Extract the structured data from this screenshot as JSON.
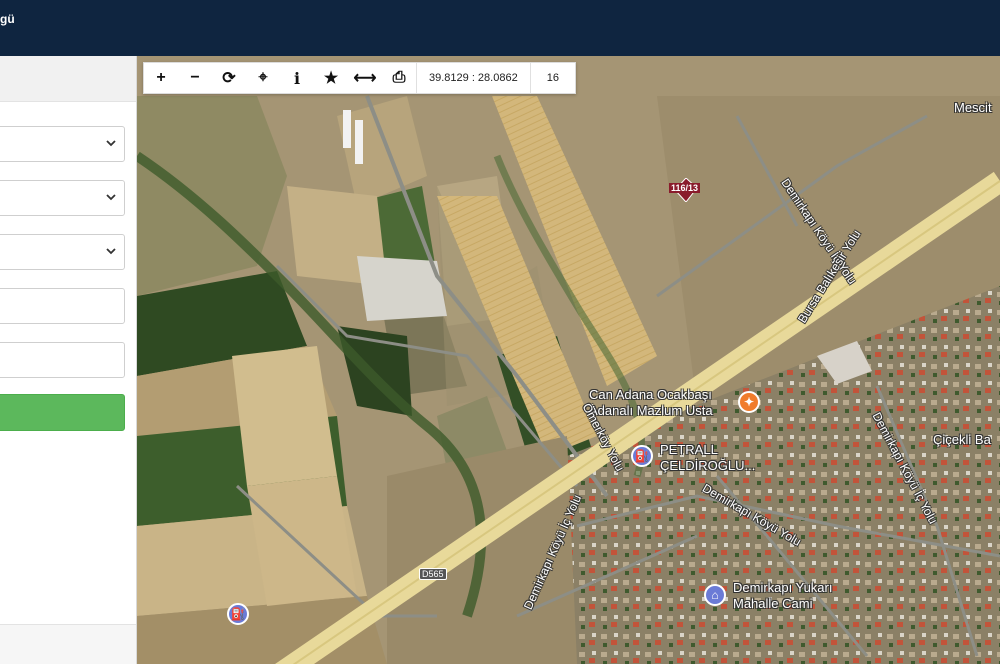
{
  "header": {
    "brand_fragment": "gü"
  },
  "sidebar": {
    "fields": [
      {
        "type": "select",
        "value": ""
      },
      {
        "type": "select",
        "value": ""
      },
      {
        "type": "select",
        "value": ""
      },
      {
        "type": "text",
        "value": ""
      },
      {
        "type": "text",
        "value": ""
      }
    ],
    "submit_label": ""
  },
  "toolbar": {
    "buttons": [
      {
        "name": "zoom-in",
        "icon": "plus-icon",
        "glyph": "+"
      },
      {
        "name": "zoom-out",
        "icon": "minus-icon",
        "glyph": "−"
      },
      {
        "name": "refresh",
        "icon": "refresh-icon",
        "glyph": "⟳"
      },
      {
        "name": "locate",
        "icon": "crosshair-icon",
        "glyph": "⌖"
      },
      {
        "name": "info",
        "icon": "info-icon",
        "glyph": "i"
      },
      {
        "name": "favorite",
        "icon": "star-icon",
        "glyph": "★"
      },
      {
        "name": "measure",
        "icon": "measure-icon",
        "glyph": "⟷"
      },
      {
        "name": "print",
        "icon": "print-icon",
        "glyph": "⎙"
      }
    ],
    "coordinates": "39.8129 : 28.0862",
    "zoom_level": "16"
  },
  "map": {
    "parcel_label": "116/13",
    "labels": {
      "mescit": "Mescit",
      "demirkapi_koyu_ic_yolu_north": "Demirkapı Köyü İç Yolu",
      "bursa_balikesir_yolu": "Bursa Balıkesir Yolu",
      "can_adana_line1": "Can Adana Ocakbaşı",
      "can_adana_line2": "Adanalı Mazlum Usta",
      "omerkoy_yolu": "Ömerköy Yolu",
      "petrall_line1": "PETRALL",
      "petrall_line2": "ÇELDİROĞLU...",
      "demirkapi_koyu_yolu": "Demirkapı Köyü Yolu",
      "demirkapi_koyu_ic_yolu_east": "Demirkapı Köyü İç Yolu",
      "demirkapi_koyu_ic_yolu_south": "Demirkapı Köyü İç Yolu",
      "cicekli_ba": "Çiçekli Ba",
      "cami_line1": "Demirkapı Yukarı",
      "cami_line2": "Mahalle Cami",
      "route_d565": "D565"
    },
    "colors": {
      "fuel_poi": "#6b7bd6",
      "food_poi": "#f07c2c",
      "highway": "#e8d99a",
      "parcel": "#8a1c2c"
    }
  }
}
